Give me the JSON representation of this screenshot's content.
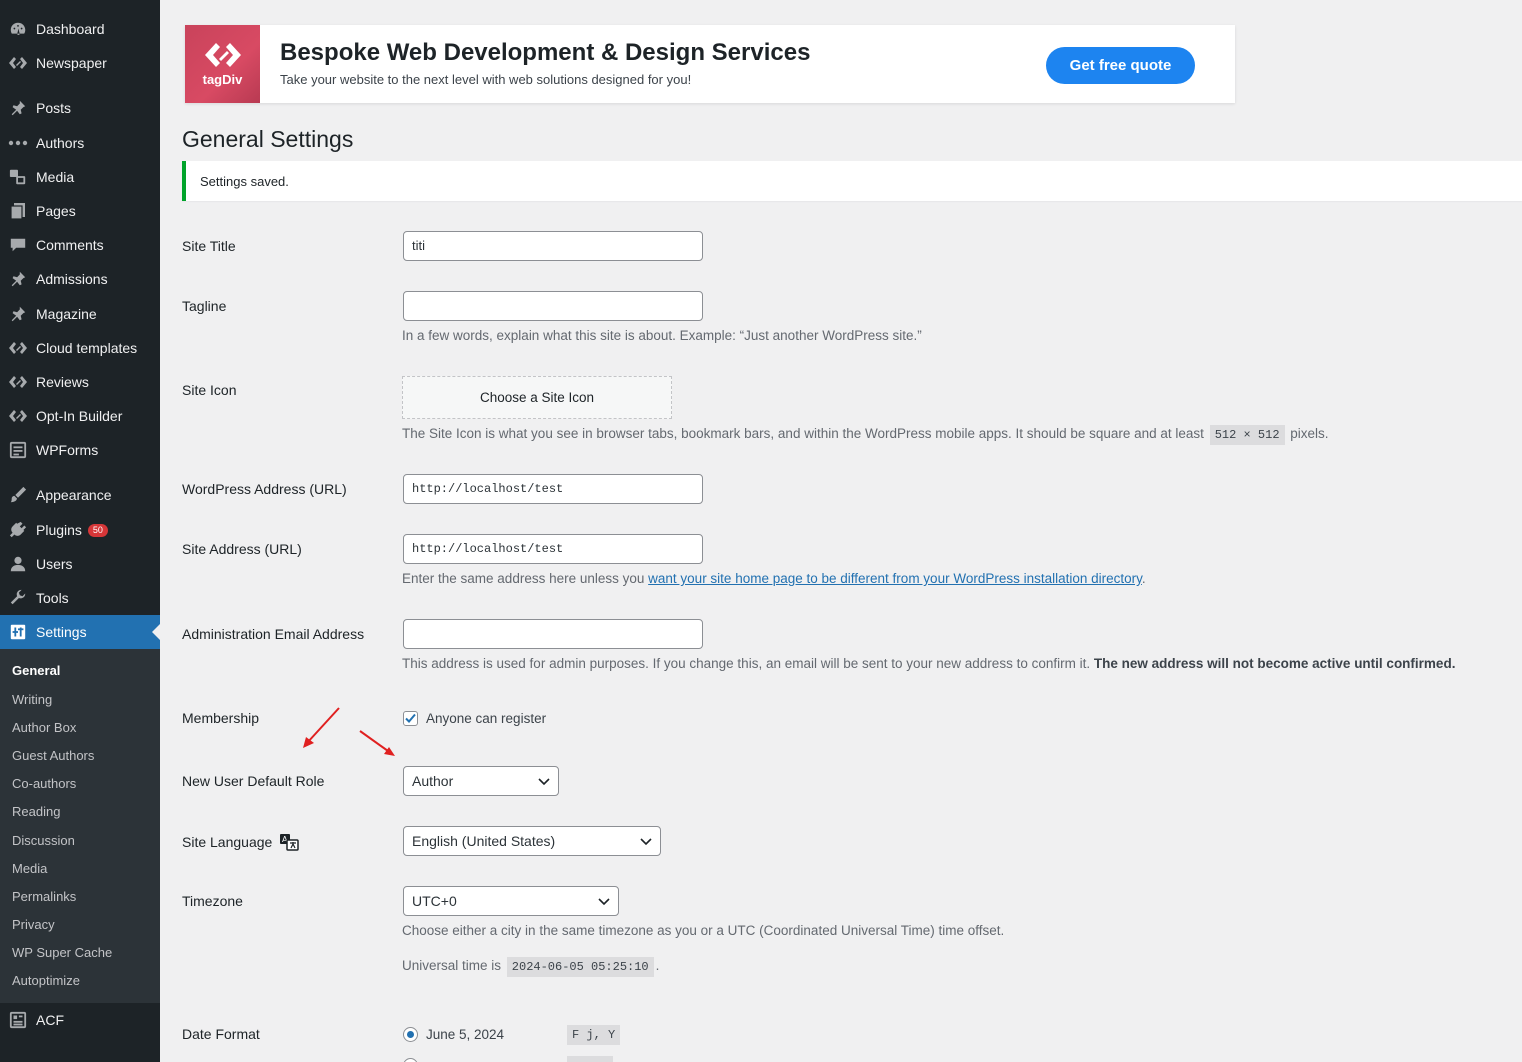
{
  "sidebar": {
    "items": [
      {
        "label": "Dashboard",
        "icon": "dashboard-icon"
      },
      {
        "label": "Newspaper",
        "icon": "tagdiv-icon"
      },
      {
        "label": "Posts",
        "icon": "pin-icon"
      },
      {
        "label": "Authors",
        "icon": "dots-icon"
      },
      {
        "label": "Media",
        "icon": "media-icon"
      },
      {
        "label": "Pages",
        "icon": "page-icon"
      },
      {
        "label": "Comments",
        "icon": "comment-icon"
      },
      {
        "label": "Admissions",
        "icon": "pin-icon"
      },
      {
        "label": "Magazine",
        "icon": "pin-icon"
      },
      {
        "label": "Cloud templates",
        "icon": "tagdiv-icon"
      },
      {
        "label": "Reviews",
        "icon": "tagdiv-icon"
      },
      {
        "label": "Opt-In Builder",
        "icon": "tagdiv-icon"
      },
      {
        "label": "WPForms",
        "icon": "form-icon"
      },
      {
        "label": "Appearance",
        "icon": "brush-icon"
      },
      {
        "label": "Plugins",
        "icon": "plug-icon",
        "badge": "50"
      },
      {
        "label": "Users",
        "icon": "user-icon"
      },
      {
        "label": "Tools",
        "icon": "wrench-icon"
      },
      {
        "label": "Settings",
        "icon": "settings-icon"
      },
      {
        "label": "ACF",
        "icon": "acf-icon"
      }
    ],
    "submenu": [
      "General",
      "Writing",
      "Author Box",
      "Guest Authors",
      "Co-authors",
      "Reading",
      "Discussion",
      "Media",
      "Permalinks",
      "Privacy",
      "WP Super Cache",
      "Autoptimize"
    ]
  },
  "banner": {
    "logo_text": "tagDiv",
    "title": "Bespoke Web Development & Design Services",
    "subtitle": "Take your website to the next level with web solutions designed for you!",
    "button": "Get free quote"
  },
  "page": {
    "title": "General Settings",
    "notice": "Settings saved."
  },
  "form": {
    "site_title": {
      "label": "Site Title",
      "value": "titi"
    },
    "tagline": {
      "label": "Tagline",
      "value": "",
      "desc": "In a few words, explain what this site is about. Example: “Just another WordPress site.”"
    },
    "site_icon": {
      "label": "Site Icon",
      "button": "Choose a Site Icon",
      "desc_before": "The Site Icon is what you see in browser tabs, bookmark bars, and within the WordPress mobile apps. It should be square and at least",
      "size": "512 × 512",
      "desc_after": "pixels."
    },
    "wp_address": {
      "label": "WordPress Address (URL)",
      "value": "http://localhost/test"
    },
    "site_address": {
      "label": "Site Address (URL)",
      "value": "http://localhost/test",
      "desc_before": "Enter the same address here unless you",
      "link": "want your site home page to be different from your WordPress installation directory",
      "desc_after": "."
    },
    "admin_email": {
      "label": "Administration Email Address",
      "value": "",
      "desc": "This address is used for admin purposes. If you change this, an email will be sent to your new address to confirm it.",
      "desc_bold": "The new address will not become active until confirmed."
    },
    "membership": {
      "label": "Membership",
      "checkbox": "Anyone can register",
      "checked": true
    },
    "default_role": {
      "label": "New User Default Role",
      "value": "Author"
    },
    "language": {
      "label": "Site Language",
      "value": "English (United States)"
    },
    "timezone": {
      "label": "Timezone",
      "value": "UTC+0",
      "desc": "Choose either a city in the same timezone as you or a UTC (Coordinated Universal Time) time offset.",
      "universal_label": "Universal time is",
      "universal_value": "2024-06-05 05:25:10",
      "universal_after": "."
    },
    "date_format": {
      "label": "Date Format",
      "option1": "June 5, 2024",
      "option1_code": "F j, Y"
    }
  },
  "colors": {
    "accent": "#2271b1",
    "success": "#00a32a",
    "annotation_arrow": "#e02020",
    "sidebar_bg": "#1d2327"
  }
}
